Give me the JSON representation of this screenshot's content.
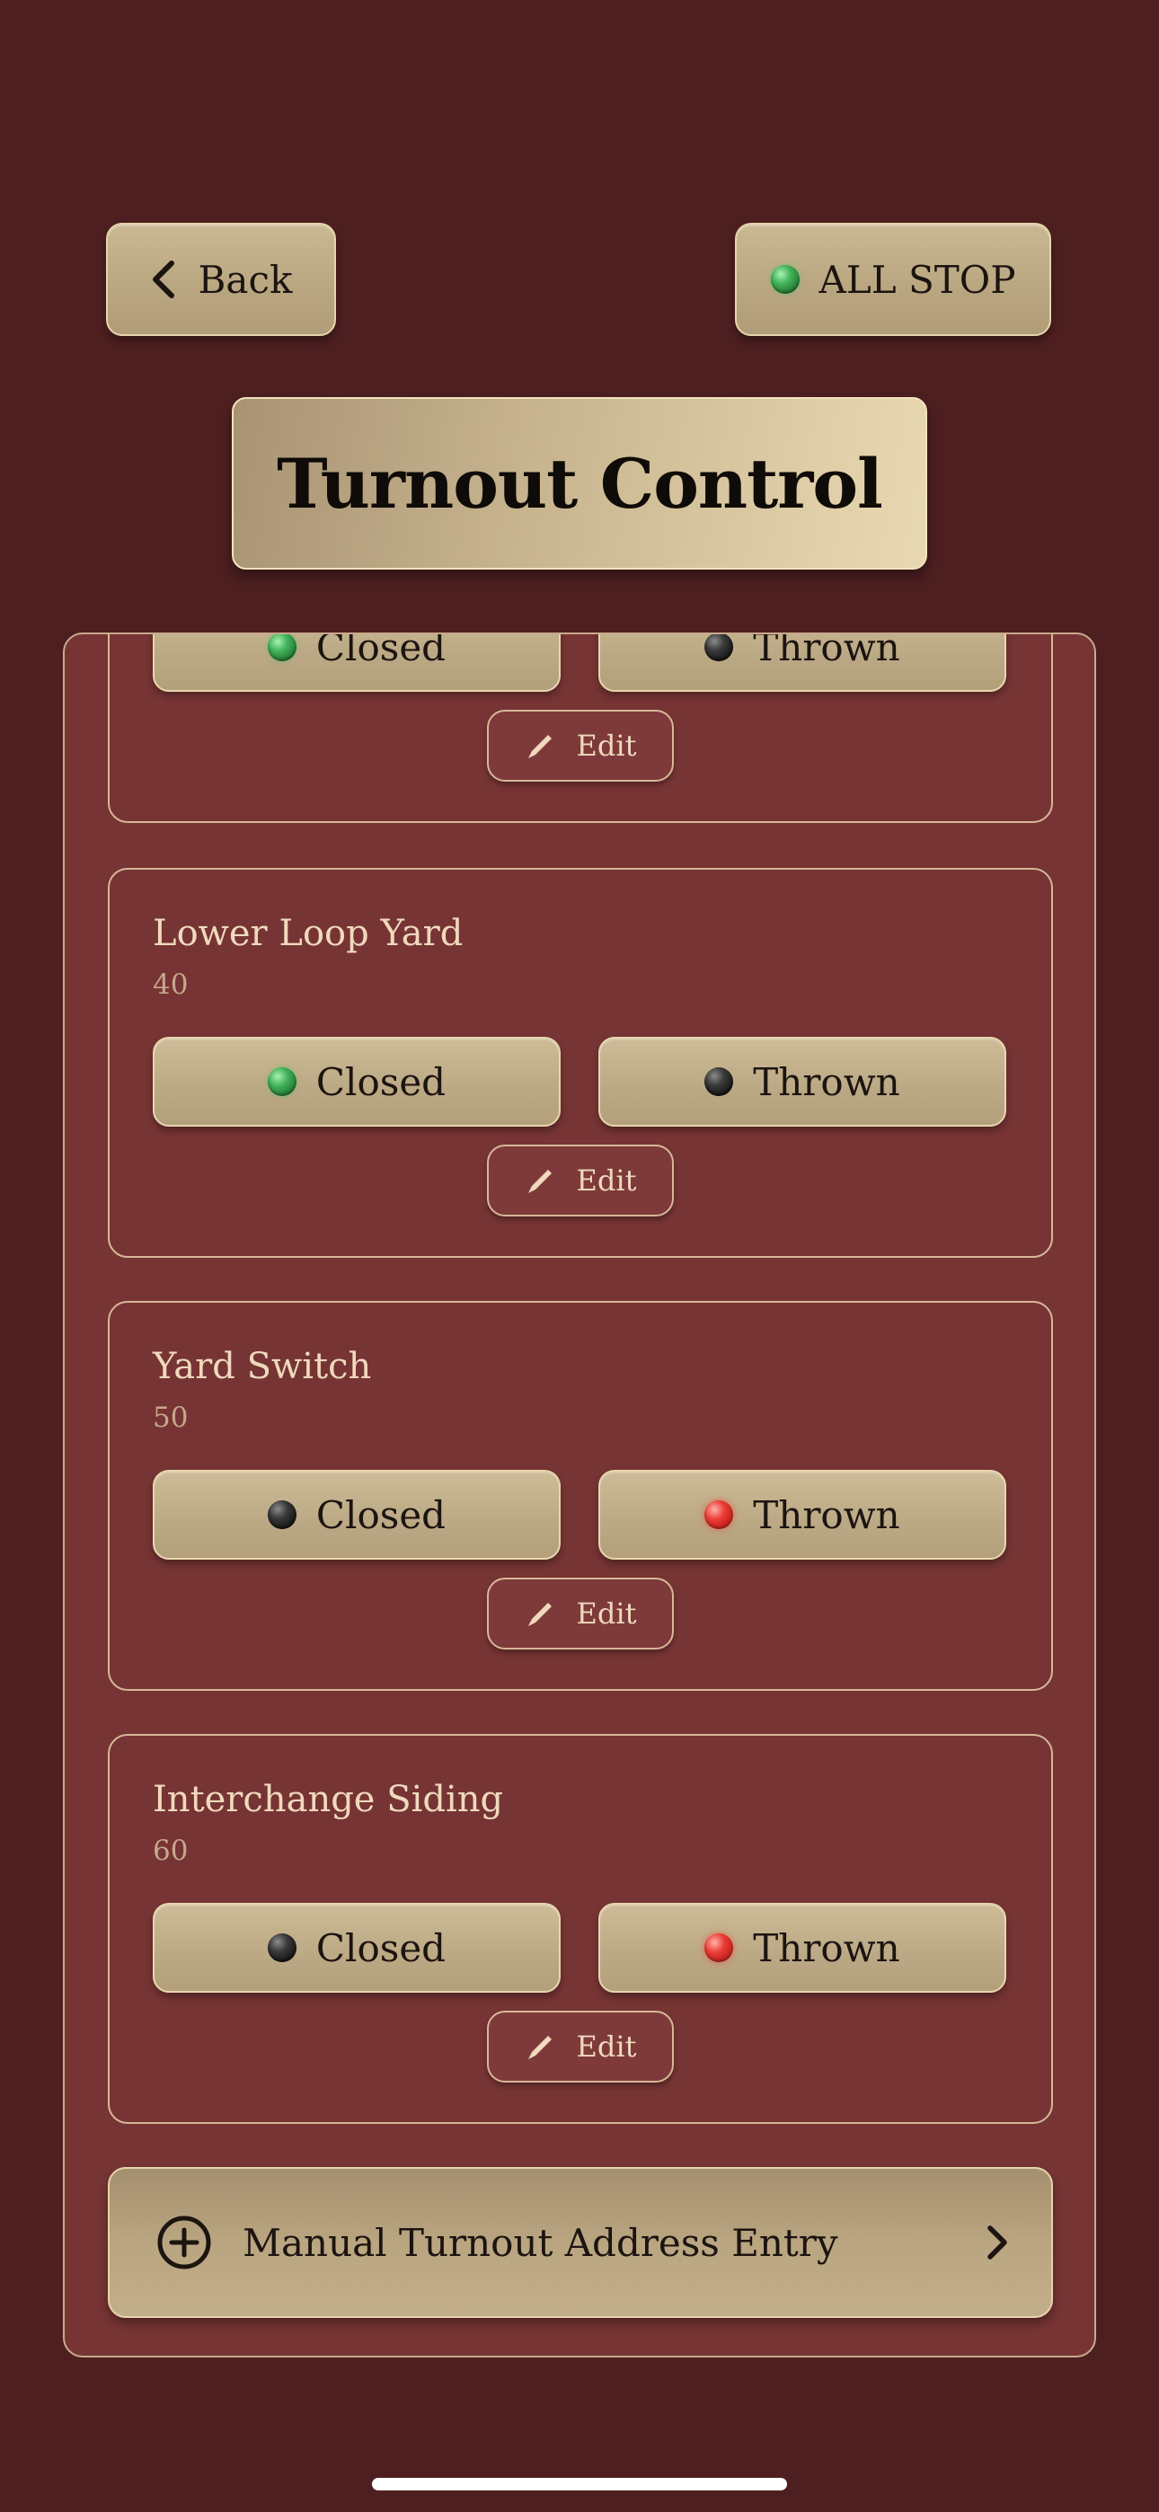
{
  "header": {
    "back_label": "Back",
    "all_stop_label": "ALL STOP",
    "all_stop_led_color": "#43b45a"
  },
  "title": "Turnout Control",
  "turnouts": [
    {
      "name": "",
      "address": "",
      "closed_label": "Closed",
      "thrown_label": "Thrown",
      "state": "closed",
      "edit_label": "Edit"
    },
    {
      "name": "Lower Loop Yard",
      "address": "40",
      "closed_label": "Closed",
      "thrown_label": "Thrown",
      "state": "closed",
      "edit_label": "Edit"
    },
    {
      "name": "Yard Switch",
      "address": "50",
      "closed_label": "Closed",
      "thrown_label": "Thrown",
      "state": "thrown",
      "edit_label": "Edit"
    },
    {
      "name": "Interchange Siding",
      "address": "60",
      "closed_label": "Closed",
      "thrown_label": "Thrown",
      "state": "thrown",
      "edit_label": "Edit"
    }
  ],
  "manual_entry": {
    "label": "Manual Turnout Address Entry",
    "icon": "plus-circle-icon",
    "chevron_icon": "chevron-right-icon"
  },
  "colors": {
    "background": "#4e1f20",
    "panel": "#773434",
    "button_tan": "#bba884",
    "led_closed_active": "#43b45a",
    "led_thrown_active": "#ec3b33",
    "led_inactive": "#121212"
  }
}
